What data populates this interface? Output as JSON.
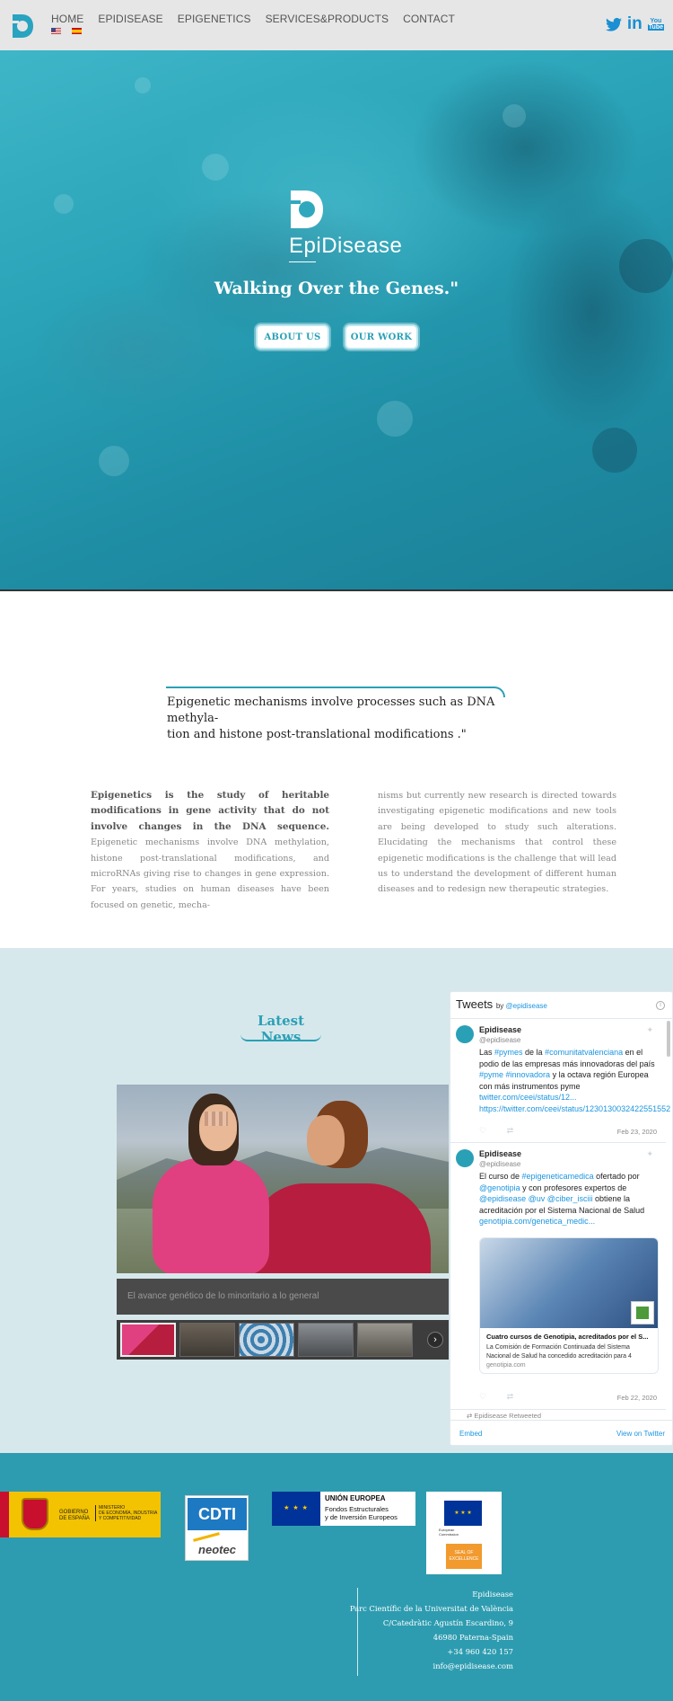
{
  "header": {
    "nav": [
      "HOME",
      "EPIDISEASE",
      "EPIGENETICS",
      "SERVICES&PRODUCTS",
      "CONTACT"
    ],
    "social": {
      "twitter": "twitter-icon",
      "linkedin": "in",
      "youtube_top": "You",
      "youtube_bottom": "Tube"
    }
  },
  "hero": {
    "brand": "EpiDisease",
    "tagline": "Walking Over the Genes.\"",
    "buttons": [
      "ABOUT US",
      "OUR WORK"
    ]
  },
  "quote": {
    "line1": "Epigenetic mechanisms involve processes such as DNA methyla-",
    "line2": "tion and histone post-translational modifications .\""
  },
  "intro": {
    "bold": "Epigenetics is the study of heritable modifications in gene activity that do not involve changes in the DNA sequence.",
    "col1_rest": " Epigenetic mechanisms involve DNA methylation, histone post-translational modifications, and microRNAs giving rise to changes in gene expression. For years, studies on human diseases have been focused on genetic, mecha-",
    "col2": "nisms but currently new research is directed towards investigating epigenetic modifications and new tools are being developed to study such alterations. Elucidating the mechanisms that control these epigenetic modifications is the challenge that will lead us to understand the development of different human diseases and to redesign new therapeutic strategies."
  },
  "news": {
    "title": "Latest News",
    "caption": "El avance genético de lo minoritario a lo general",
    "next": "›"
  },
  "twitter": {
    "title": "Tweets",
    "by": "by",
    "handle_link": "@epidisease",
    "tweets": [
      {
        "name": "Epidisease",
        "handle": "@epidisease",
        "body_prefix": "Las ",
        "body_tags1": "#pymes",
        "body_mid1": " de la ",
        "body_tags2": "#comunitatvalenciana",
        "body_mid2": " en el podio de las empresas más innovadoras del país ",
        "body_tags3": "#pyme #innovadora",
        "body_mid3": " y la octava región Europea con más instrumentos pyme ",
        "body_link": "twitter.com/ceei/status/12... https://twitter.com/ceei/status/1230130032422551552",
        "date": "Feb 23, 2020"
      },
      {
        "name": "Epidisease",
        "handle": "@epidisease",
        "body_prefix": "El curso de ",
        "body_tags1": "#epigeneticamedica",
        "body_mid1": " ofertado por ",
        "body_tags2": "@genotipia",
        "body_mid2": " y con profesores expertos de ",
        "body_tags3": "@epidisease @uv @ciber_isciii",
        "body_mid3": " obtiene la acreditación por el Sistema Nacional de Salud ",
        "body_link": "genotipia.com/genetica_medic...",
        "card_title": "Cuatro cursos de Genotipia, acreditados por el S...",
        "card_desc": "La Comisión de Formación Continuada del Sistema Nacional de Salud ha concedido acreditación para 4",
        "card_domain": "genotipia.com",
        "date": "Feb 22, 2020"
      }
    ],
    "partial": "Epidisease Retweeted",
    "embed": "Embed",
    "view": "View on Twitter"
  },
  "footer": {
    "gob_line1": "GOBIERNO",
    "gob_line2": "DE ESPAÑA",
    "gob_min1": "MINISTERIO",
    "gob_min2": "DE ECONOMÍA, INDUSTRIA",
    "gob_min3": "Y COMPETITIVIDAD",
    "cdti": "CDTI",
    "neotec": "neotec",
    "ue_title": "UNIÓN EUROPEA",
    "ue_line1": "Fondos Estructurales",
    "ue_line2": "y de Inversión Europeos",
    "exc_line1": "European",
    "exc_line2": "Commission",
    "exc_badge1": "SEAL OF",
    "exc_badge2": "EXCELLENCE",
    "address": [
      "Epidisease",
      "Parc Científic de la Universitat de València",
      "C/Catedràtic Agustín Escardino, 9",
      "46980 Paterna-Spain",
      "+34 960 420 157",
      "info@epidisease.com"
    ]
  }
}
